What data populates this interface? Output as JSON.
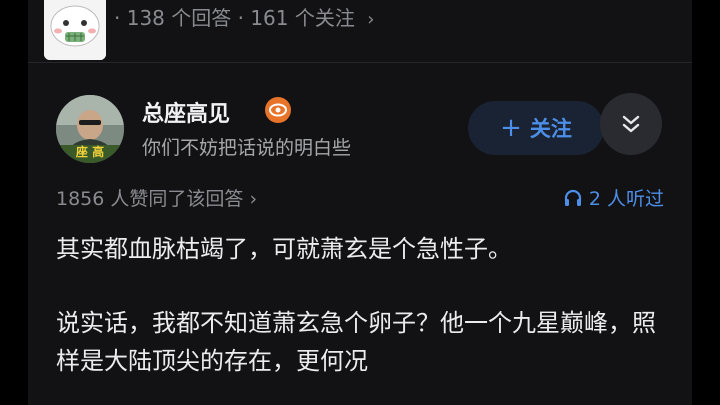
{
  "question": {
    "answers_count": "138 个回答",
    "followers_count": "161 个关注",
    "separator": "·",
    "chevron": "›"
  },
  "author": {
    "name": "总座高见",
    "bio": "你们不妨把话说的明白些",
    "avatar_caption": "座 高"
  },
  "actions": {
    "follow_label": "关注",
    "follow_icon": "plus-icon",
    "expand_icon": "double-chevron-down-icon"
  },
  "stats": {
    "likes_text": "1856 人赞同了该回答",
    "chevron": "›",
    "listeners_text": "2 人听过"
  },
  "answer": {
    "paragraphs": [
      "其实都血脉枯竭了，可就萧玄是个急性子。",
      "说实话，我都不知道萧玄急个卵子？他一个九星巅峰，照样是大陆顶尖的存在，更何况"
    ]
  },
  "colors": {
    "background": "#121214",
    "accent": "#4d8fe8",
    "follow_bg": "#1a2333",
    "badge": "#e8742a"
  }
}
